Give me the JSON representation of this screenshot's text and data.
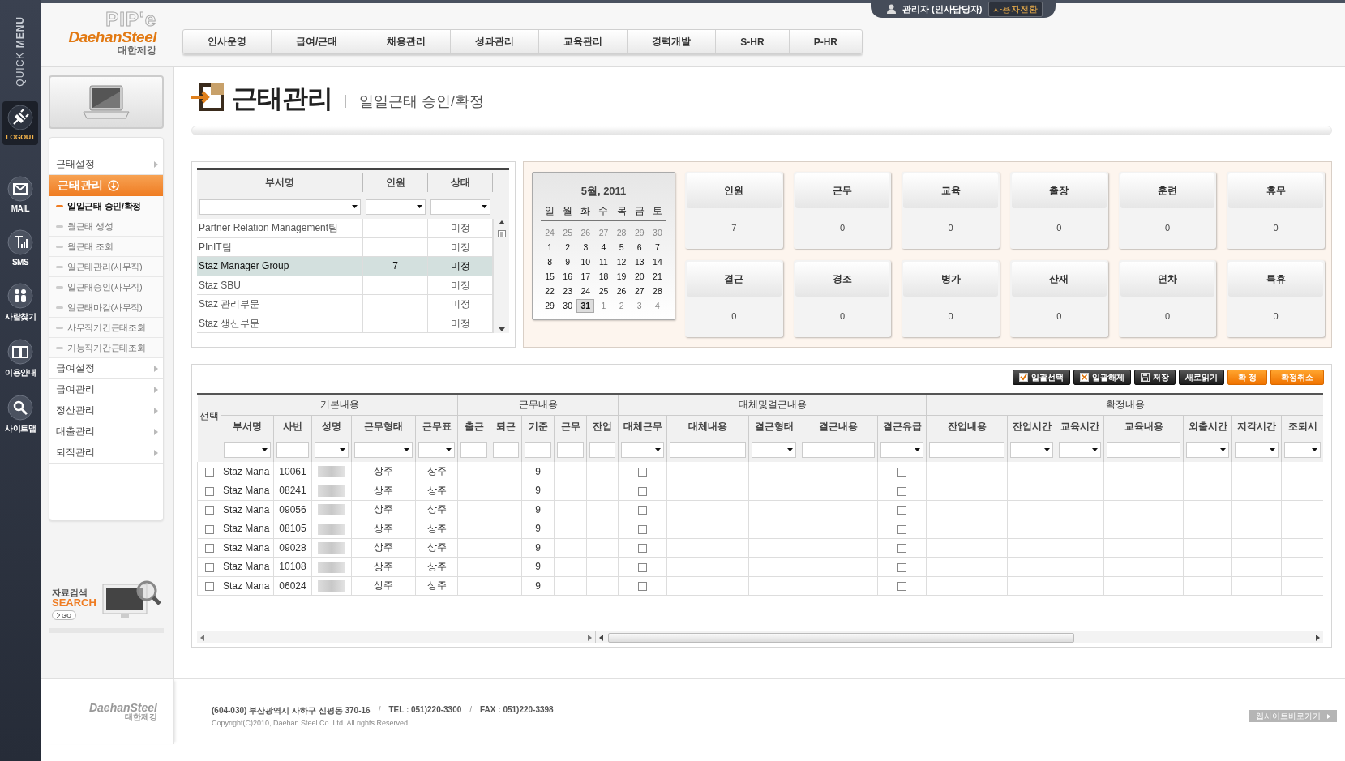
{
  "quick_menu": {
    "title": "QUICK **MENU**",
    "items": [
      {
        "label": "LOGOUT",
        "kind": "logout"
      },
      {
        "label": "MAIL",
        "kind": "mail"
      },
      {
        "label": "SMS",
        "kind": "sms"
      },
      {
        "label": "사람찾기",
        "kind": "people"
      },
      {
        "label": "이용안내",
        "kind": "guide"
      },
      {
        "label": "사이트맵",
        "kind": "search"
      }
    ]
  },
  "logo": {
    "product": "PIP'e",
    "brand": "DaehanSteel",
    "brand_ko": "대한제강"
  },
  "nav": [
    "인사운영",
    "급여/근태",
    "채용관리",
    "성과관리",
    "교육관리",
    "경력개발",
    "S-HR",
    "P-HR"
  ],
  "user": {
    "name": "관리자 (인사담당자)",
    "switch_button": "사용자전환"
  },
  "sidebar": {
    "menu": [
      {
        "label": "근태설정",
        "selected": false,
        "expanded": false
      },
      {
        "label": "근태관리",
        "selected": true,
        "expanded": true,
        "children": [
          {
            "label": "일일근태 승인/확정",
            "selected": true
          },
          {
            "label": "월근태 생성",
            "selected": false
          },
          {
            "label": "월근태 조회",
            "selected": false
          },
          {
            "label": "일근태관리(사무직)",
            "selected": false
          },
          {
            "label": "일근태승인(사무직)",
            "selected": false
          },
          {
            "label": "일근태마감(사무직)",
            "selected": false
          },
          {
            "label": "사무직기간근태조회",
            "selected": false
          },
          {
            "label": "기능직기간근태조회",
            "selected": false
          }
        ]
      },
      {
        "label": "급여설정",
        "selected": false,
        "expanded": false
      },
      {
        "label": "급여관리",
        "selected": false,
        "expanded": false
      },
      {
        "label": "정산관리",
        "selected": false,
        "expanded": false
      },
      {
        "label": "대출관리",
        "selected": false,
        "expanded": false
      },
      {
        "label": "퇴직관리",
        "selected": false,
        "expanded": false
      }
    ],
    "search": {
      "label": "자료검색",
      "title": "SEARCH",
      "go": "GO"
    }
  },
  "page": {
    "title": "근태관리",
    "subtitle": "일일근태 승인/확정"
  },
  "departments": {
    "columns": [
      "부서명",
      "인원",
      "상태"
    ],
    "rows": [
      {
        "name": "Partner Relation Management팀",
        "status": "미정",
        "selected": false
      },
      {
        "name": "PInIT팀",
        "status": "미정",
        "selected": false
      },
      {
        "name": "Staz Manager Group",
        "count": "7",
        "status": "미정",
        "selected": true
      },
      {
        "name": "Staz SBU",
        "status": "미정",
        "selected": false
      },
      {
        "name": "Staz 관리부문",
        "status": "미정",
        "selected": false
      },
      {
        "name": "Staz 생산부문",
        "status": "미정",
        "selected": false
      }
    ]
  },
  "calendar": {
    "title": "5월, 2011",
    "weekdays": [
      "일",
      "월",
      "화",
      "수",
      "목",
      "금",
      "토"
    ],
    "weeks": [
      [
        {
          "day": "24",
          "other_month": true,
          "selected": false
        },
        {
          "day": "25",
          "other_month": true,
          "selected": false
        },
        {
          "day": "26",
          "other_month": true,
          "selected": false
        },
        {
          "day": "27",
          "other_month": true,
          "selected": false
        },
        {
          "day": "28",
          "other_month": true,
          "selected": false
        },
        {
          "day": "29",
          "other_month": true,
          "selected": false
        },
        {
          "day": "30",
          "other_month": true,
          "selected": false
        }
      ],
      [
        {
          "day": "1",
          "other_month": false,
          "selected": false
        },
        {
          "day": "2",
          "other_month": false,
          "selected": false
        },
        {
          "day": "3",
          "other_month": false,
          "selected": false
        },
        {
          "day": "4",
          "other_month": false,
          "selected": false
        },
        {
          "day": "5",
          "other_month": false,
          "selected": false
        },
        {
          "day": "6",
          "other_month": false,
          "selected": false
        },
        {
          "day": "7",
          "other_month": false,
          "selected": false
        }
      ],
      [
        {
          "day": "8",
          "other_month": false,
          "selected": false
        },
        {
          "day": "9",
          "other_month": false,
          "selected": false
        },
        {
          "day": "10",
          "other_month": false,
          "selected": false
        },
        {
          "day": "11",
          "other_month": false,
          "selected": false
        },
        {
          "day": "12",
          "other_month": false,
          "selected": false
        },
        {
          "day": "13",
          "other_month": false,
          "selected": false
        },
        {
          "day": "14",
          "other_month": false,
          "selected": false
        }
      ],
      [
        {
          "day": "15",
          "other_month": false,
          "selected": false
        },
        {
          "day": "16",
          "other_month": false,
          "selected": false
        },
        {
          "day": "17",
          "other_month": false,
          "selected": false
        },
        {
          "day": "18",
          "other_month": false,
          "selected": false
        },
        {
          "day": "19",
          "other_month": false,
          "selected": false
        },
        {
          "day": "20",
          "other_month": false,
          "selected": false
        },
        {
          "day": "21",
          "other_month": false,
          "selected": false
        }
      ],
      [
        {
          "day": "22",
          "other_month": false,
          "selected": false
        },
        {
          "day": "23",
          "other_month": false,
          "selected": false
        },
        {
          "day": "24",
          "other_month": false,
          "selected": false
        },
        {
          "day": "25",
          "other_month": false,
          "selected": false
        },
        {
          "day": "26",
          "other_month": false,
          "selected": false
        },
        {
          "day": "27",
          "other_month": false,
          "selected": false
        },
        {
          "day": "28",
          "other_month": false,
          "selected": false
        }
      ],
      [
        {
          "day": "29",
          "other_month": false,
          "selected": false
        },
        {
          "day": "30",
          "other_month": false,
          "selected": false
        },
        {
          "day": "31",
          "other_month": false,
          "selected": true
        },
        {
          "day": "1",
          "other_month": true,
          "selected": false
        },
        {
          "day": "2",
          "other_month": true,
          "selected": false
        },
        {
          "day": "3",
          "other_month": true,
          "selected": false
        },
        {
          "day": "4",
          "other_month": true,
          "selected": false
        }
      ]
    ]
  },
  "stats": [
    {
      "label": "인원",
      "value": "7"
    },
    {
      "label": "근무",
      "value": "0"
    },
    {
      "label": "교육",
      "value": "0"
    },
    {
      "label": "출장",
      "value": "0"
    },
    {
      "label": "훈련",
      "value": "0"
    },
    {
      "label": "휴무",
      "value": "0"
    },
    {
      "label": "결근",
      "value": "0"
    },
    {
      "label": "경조",
      "value": "0"
    },
    {
      "label": "병가",
      "value": "0"
    },
    {
      "label": "산재",
      "value": "0"
    },
    {
      "label": "연차",
      "value": "0"
    },
    {
      "label": "특휴",
      "value": "0"
    }
  ],
  "attendance": {
    "buttons": [
      {
        "label": "일괄선택",
        "kind": "check"
      },
      {
        "label": "일괄해제",
        "kind": "uncheck"
      },
      {
        "label": "저장",
        "kind": "save"
      },
      {
        "label": "새로읽기",
        "kind": "plain"
      },
      {
        "label": "확 정",
        "kind": "primary"
      },
      {
        "label": "확정취소",
        "kind": "primary"
      }
    ],
    "select_column": "선택",
    "groups": [
      {
        "label": "기본내용",
        "columns": [
          {
            "label": "부서명",
            "kind": "select"
          },
          {
            "label": "사번",
            "kind": "text"
          },
          {
            "label": "성명",
            "kind": "select"
          },
          {
            "label": "근무형태",
            "kind": "select"
          },
          {
            "label": "근무표",
            "kind": "select"
          }
        ]
      },
      {
        "label": "근무내용",
        "columns": [
          {
            "label": "출근",
            "kind": "text"
          },
          {
            "label": "퇴근",
            "kind": "text"
          },
          {
            "label": "기준",
            "kind": "text"
          },
          {
            "label": "근무",
            "kind": "text"
          },
          {
            "label": "잔업",
            "kind": "text"
          }
        ]
      },
      {
        "label": "대체및결근내용",
        "columns": [
          {
            "label": "대체근무",
            "kind": "select"
          },
          {
            "label": "대체내용",
            "kind": "text"
          },
          {
            "label": "결근형태",
            "kind": "select"
          },
          {
            "label": "결근내용",
            "kind": "text"
          },
          {
            "label": "결근유급",
            "kind": "select"
          }
        ]
      },
      {
        "label": "확정내용",
        "columns": [
          {
            "label": "잔업내용",
            "kind": "text"
          },
          {
            "label": "잔업시간",
            "kind": "select"
          },
          {
            "label": "교육시간",
            "kind": "select"
          },
          {
            "label": "교육내용",
            "kind": "text"
          },
          {
            "label": "외출시간",
            "kind": "select"
          },
          {
            "label": "지각시간",
            "kind": "select"
          },
          {
            "label": "조퇴시",
            "kind": "select"
          }
        ]
      }
    ],
    "rows": [
      {
        "checked": false,
        "department": "Staz Mana",
        "employee_no": "10061",
        "work_type": "상주",
        "schedule": "상주",
        "standard": "9",
        "substitute": false,
        "absence_paid": false
      },
      {
        "checked": false,
        "department": "Staz Mana",
        "employee_no": "08241",
        "work_type": "상주",
        "schedule": "상주",
        "standard": "9",
        "substitute": false,
        "absence_paid": false
      },
      {
        "checked": false,
        "department": "Staz Mana",
        "employee_no": "09056",
        "work_type": "상주",
        "schedule": "상주",
        "standard": "9",
        "substitute": false,
        "absence_paid": false
      },
      {
        "checked": false,
        "department": "Staz Mana",
        "employee_no": "08105",
        "work_type": "상주",
        "schedule": "상주",
        "standard": "9",
        "substitute": false,
        "absence_paid": false
      },
      {
        "checked": false,
        "department": "Staz Mana",
        "employee_no": "09028",
        "work_type": "상주",
        "schedule": "상주",
        "standard": "9",
        "substitute": false,
        "absence_paid": false
      },
      {
        "checked": false,
        "department": "Staz Mana",
        "employee_no": "10108",
        "work_type": "상주",
        "schedule": "상주",
        "standard": "9",
        "substitute": false,
        "absence_paid": false
      },
      {
        "checked": false,
        "department": "Staz Mana",
        "employee_no": "06024",
        "work_type": "상주",
        "schedule": "상주",
        "standard": "9",
        "substitute": false,
        "absence_paid": false
      }
    ]
  },
  "footer": {
    "brand": "DaehanSteel",
    "brand_ko": "대한제강",
    "address": [
      "(604-030) 부산광역시 사하구 신평동 370-16",
      "/",
      "TEL : 051)220-3300",
      "/",
      "FAX : 051)220-3398"
    ],
    "copyright": "Copyright(C)2010, Daehan Steel Co.,Ltd. All rights Reserved.",
    "link": "웹사이트바로가기"
  }
}
